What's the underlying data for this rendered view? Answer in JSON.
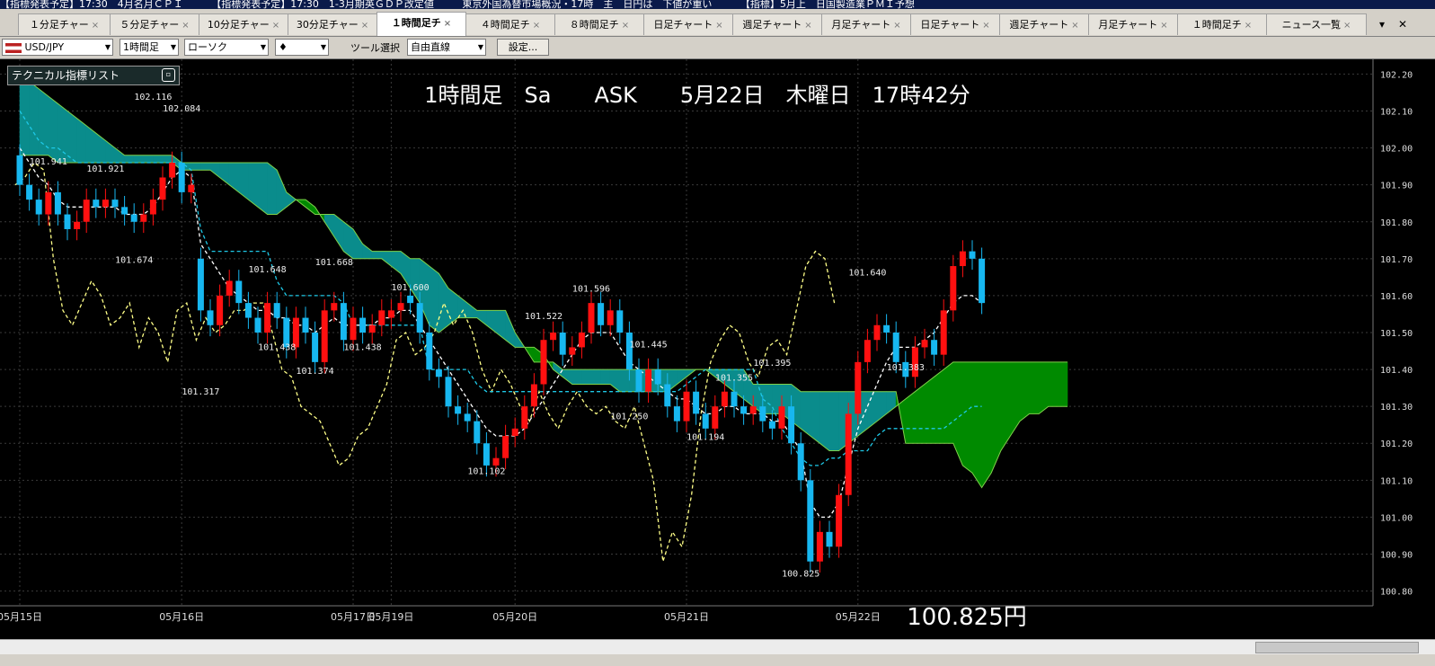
{
  "ticker": [
    "【指標発表予定】17:30　4月名月ＣＰＩ",
    "【指標発表予定】17:30　1-3月期英ＧＤＰ改定値",
    "東京外国為替市場概況・17時　主　日円は　下値が重い",
    "【指標】5月上　日国製造業ＰＭＩ予想"
  ],
  "tabs": [
    "１分足チャー",
    "５分足チャー",
    "10分足チャー",
    "30分足チャー",
    "１時間足チ",
    "４時間足チ",
    "８時間足チ",
    "日足チャート",
    "週足チャート",
    "月足チャート",
    "日足チャート",
    "週足チャート",
    "月足チャート",
    "１時間足チ",
    "ニュース一覧"
  ],
  "tab_close": "×",
  "tab_nav": "▾",
  "window_close": "✕",
  "toolbar": {
    "pair": "USD/JPY",
    "timeframe": "1時間足",
    "chart_type": "ローソク",
    "mark": "♦",
    "tool_label": "ツール選択",
    "tool_value": "自由直線",
    "settings": "設定..."
  },
  "panel": {
    "title": "テクニカル指標リスト",
    "icon": "▫"
  },
  "colors": {
    "up": "#ff1010",
    "down": "#17b7f0",
    "kumo_pos": "#008a00",
    "kumo_neg": "#0a8c8c",
    "tenkan": "#ffffff",
    "kijun": "#1ec8e6",
    "chikou": "#ffff88"
  },
  "chart_data": {
    "type": "candlestick",
    "title": "1時間足　Sa　　ASK　　5月22日　木曜日　17時42分",
    "price_label": "100.825円",
    "ylim": [
      100.76,
      102.24
    ],
    "y_ticks": [
      "102.20",
      "102.10",
      "102.00",
      "101.90",
      "101.80",
      "101.70",
      "101.60",
      "101.50",
      "101.40",
      "101.30",
      "101.20",
      "101.10",
      "101.00",
      "100.90",
      "100.80"
    ],
    "x_labels": [
      {
        "label": "05月15日",
        "i": 0
      },
      {
        "label": "05月16日",
        "i": 17
      },
      {
        "label": "05月17日",
        "i": 35
      },
      {
        "label": "05月19日",
        "i": 39
      },
      {
        "label": "05月20日",
        "i": 52
      },
      {
        "label": "05月21日",
        "i": 70
      },
      {
        "label": "05月22日",
        "i": 88
      }
    ],
    "extrema_labels": [
      {
        "label": "102.116",
        "i": 14,
        "v": 102.116
      },
      {
        "label": "102.084",
        "i": 17,
        "v": 102.084
      },
      {
        "label": "101.941",
        "i": 3,
        "v": 101.941
      },
      {
        "label": "101.921",
        "i": 9,
        "v": 101.921
      },
      {
        "label": "101.674",
        "i": 12,
        "v": 101.674
      },
      {
        "label": "101.648",
        "i": 26,
        "v": 101.648
      },
      {
        "label": "101.668",
        "i": 33,
        "v": 101.668
      },
      {
        "label": "101.317",
        "i": 19,
        "v": 101.317
      },
      {
        "label": "101.438",
        "i": 27,
        "v": 101.438
      },
      {
        "label": "101.374",
        "i": 31,
        "v": 101.374
      },
      {
        "label": "101.438",
        "i": 36,
        "v": 101.438
      },
      {
        "label": "101.600",
        "i": 41,
        "v": 101.6
      },
      {
        "label": "101.102",
        "i": 49,
        "v": 101.102
      },
      {
        "label": "101.522",
        "i": 55,
        "v": 101.522
      },
      {
        "label": "101.596",
        "i": 60,
        "v": 101.596
      },
      {
        "label": "101.445",
        "i": 66,
        "v": 101.445
      },
      {
        "label": "101.250",
        "i": 64,
        "v": 101.25
      },
      {
        "label": "101.194",
        "i": 72,
        "v": 101.194
      },
      {
        "label": "101.355",
        "i": 75,
        "v": 101.355
      },
      {
        "label": "101.395",
        "i": 79,
        "v": 101.395
      },
      {
        "label": "100.825",
        "i": 82,
        "v": 100.825
      },
      {
        "label": "101.640",
        "i": 89,
        "v": 101.64
      },
      {
        "label": "101.383",
        "i": 93,
        "v": 101.383
      }
    ],
    "closes": [
      101.9,
      101.86,
      101.82,
      101.88,
      101.82,
      101.78,
      101.8,
      101.86,
      101.84,
      101.86,
      101.84,
      101.82,
      101.8,
      101.82,
      101.86,
      101.92,
      101.96,
      101.88,
      101.9,
      101.56,
      101.52,
      101.6,
      101.64,
      101.58,
      101.54,
      101.5,
      101.58,
      101.54,
      101.46,
      101.54,
      101.5,
      101.42,
      101.56,
      101.58,
      101.48,
      101.54,
      101.5,
      101.52,
      101.56,
      101.56,
      101.58,
      101.58,
      101.5,
      101.4,
      101.38,
      101.3,
      101.28,
      101.26,
      101.2,
      101.14,
      101.16,
      101.22,
      101.24,
      101.3,
      101.36,
      101.48,
      101.5,
      101.44,
      101.46,
      101.5,
      101.58,
      101.52,
      101.56,
      101.5,
      101.4,
      101.34,
      101.4,
      101.36,
      101.3,
      101.26,
      101.34,
      101.28,
      101.24,
      101.3,
      101.34,
      101.3,
      101.28,
      101.3,
      101.26,
      101.24,
      101.3,
      101.2,
      101.1,
      100.88,
      100.96,
      100.92,
      101.06,
      101.28,
      101.42,
      101.48,
      101.52,
      101.5,
      101.42,
      101.38,
      101.46,
      101.48,
      101.44,
      101.56,
      101.68,
      101.72,
      101.7,
      101.58
    ],
    "opens": [
      101.98,
      101.9,
      101.86,
      101.82,
      101.88,
      101.82,
      101.78,
      101.8,
      101.86,
      101.84,
      101.86,
      101.84,
      101.82,
      101.8,
      101.82,
      101.86,
      101.92,
      101.96,
      101.88,
      101.7,
      101.56,
      101.52,
      101.6,
      101.64,
      101.58,
      101.54,
      101.5,
      101.58,
      101.54,
      101.46,
      101.54,
      101.5,
      101.42,
      101.56,
      101.58,
      101.48,
      101.54,
      101.5,
      101.52,
      101.54,
      101.56,
      101.6,
      101.58,
      101.5,
      101.4,
      101.38,
      101.3,
      101.28,
      101.26,
      101.2,
      101.14,
      101.16,
      101.22,
      101.24,
      101.3,
      101.36,
      101.48,
      101.5,
      101.44,
      101.46,
      101.5,
      101.58,
      101.52,
      101.56,
      101.5,
      101.4,
      101.34,
      101.4,
      101.36,
      101.3,
      101.26,
      101.34,
      101.28,
      101.24,
      101.3,
      101.34,
      101.3,
      101.28,
      101.3,
      101.26,
      101.24,
      101.3,
      101.2,
      101.1,
      100.88,
      100.96,
      100.92,
      101.06,
      101.28,
      101.42,
      101.48,
      101.52,
      101.5,
      101.42,
      101.38,
      101.46,
      101.48,
      101.44,
      101.56,
      101.68,
      101.72,
      101.7
    ],
    "tenkan": [
      102.0,
      101.96,
      101.92,
      101.9,
      101.86,
      101.84,
      101.84,
      101.84,
      101.84,
      101.84,
      101.84,
      101.82,
      101.82,
      101.82,
      101.84,
      101.88,
      101.92,
      101.94,
      101.92,
      101.74,
      101.7,
      101.66,
      101.62,
      101.6,
      101.58,
      101.56,
      101.56,
      101.54,
      101.54,
      101.52,
      101.52,
      101.5,
      101.52,
      101.54,
      101.52,
      101.52,
      101.52,
      101.52,
      101.54,
      101.54,
      101.56,
      101.56,
      101.52,
      101.48,
      101.44,
      101.4,
      101.36,
      101.32,
      101.28,
      101.24,
      101.22,
      101.22,
      101.22,
      101.24,
      101.28,
      101.32,
      101.36,
      101.4,
      101.44,
      101.48,
      101.5,
      101.5,
      101.5,
      101.46,
      101.42,
      101.4,
      101.38,
      101.36,
      101.34,
      101.32,
      101.32,
      101.3,
      101.28,
      101.28,
      101.3,
      101.3,
      101.28,
      101.28,
      101.28,
      101.26,
      101.26,
      101.22,
      101.18,
      101.04,
      101.0,
      101.0,
      101.04,
      101.14,
      101.24,
      101.3,
      101.36,
      101.42,
      101.46,
      101.46,
      101.46,
      101.48,
      101.5,
      101.54,
      101.58,
      101.6,
      101.6,
      101.58
    ],
    "kijun": [
      102.1,
      102.06,
      102.02,
      102.0,
      102.0,
      101.98,
      101.96,
      101.96,
      101.96,
      101.96,
      101.96,
      101.96,
      101.96,
      101.96,
      101.96,
      101.96,
      101.96,
      101.96,
      101.94,
      101.78,
      101.72,
      101.72,
      101.72,
      101.72,
      101.72,
      101.72,
      101.72,
      101.64,
      101.6,
      101.6,
      101.6,
      101.6,
      101.6,
      101.6,
      101.58,
      101.52,
      101.52,
      101.52,
      101.52,
      101.52,
      101.52,
      101.52,
      101.52,
      101.4,
      101.4,
      101.4,
      101.4,
      101.4,
      101.36,
      101.34,
      101.34,
      101.34,
      101.34,
      101.34,
      101.34,
      101.34,
      101.34,
      101.34,
      101.34,
      101.34,
      101.34,
      101.34,
      101.34,
      101.34,
      101.34,
      101.34,
      101.34,
      101.34,
      101.34,
      101.34,
      101.36,
      101.38,
      101.4,
      101.4,
      101.4,
      101.4,
      101.4,
      101.4,
      101.32,
      101.3,
      101.24,
      101.2,
      101.16,
      101.14,
      101.14,
      101.16,
      101.16,
      101.18,
      101.18,
      101.18,
      101.22,
      101.24,
      101.24,
      101.24,
      101.24,
      101.24,
      101.24,
      101.24,
      101.26,
      101.28,
      101.3,
      101.3
    ],
    "chikou": [
      101.9,
      101.92,
      101.96,
      101.94,
      101.7,
      101.56,
      101.52,
      101.58,
      101.64,
      101.6,
      101.52,
      101.54,
      101.58,
      101.46,
      101.54,
      101.5,
      101.42,
      101.56,
      101.58,
      101.48,
      101.54,
      101.5,
      101.52,
      101.56,
      101.56,
      101.58,
      101.58,
      101.5,
      101.4,
      101.38,
      101.3,
      101.28,
      101.26,
      101.2,
      101.14,
      101.16,
      101.22,
      101.24,
      101.3,
      101.36,
      101.48,
      101.5,
      101.44,
      101.46,
      101.5,
      101.58,
      101.52,
      101.56,
      101.5,
      101.4,
      101.34,
      101.4,
      101.36,
      101.3,
      101.26,
      101.34,
      101.28,
      101.24,
      101.3,
      101.34,
      101.3,
      101.28,
      101.3,
      101.26,
      101.24,
      101.3,
      101.2,
      101.1,
      100.88,
      100.96,
      100.92,
      101.06,
      101.28,
      101.42,
      101.48,
      101.52,
      101.5,
      101.42,
      101.38,
      101.46,
      101.48,
      101.44,
      101.56,
      101.68,
      101.72,
      101.7,
      101.58
    ],
    "senkou_a": [
      101.98,
      101.98,
      101.98,
      101.98,
      101.96,
      101.96,
      101.96,
      101.96,
      101.96,
      101.96,
      101.96,
      101.96,
      101.96,
      101.96,
      101.96,
      101.96,
      101.96,
      101.94,
      101.94,
      101.94,
      101.94,
      101.92,
      101.9,
      101.88,
      101.86,
      101.84,
      101.82,
      101.82,
      101.84,
      101.86,
      101.86,
      101.84,
      101.8,
      101.76,
      101.72,
      101.7,
      101.7,
      101.7,
      101.7,
      101.68,
      101.66,
      101.62,
      101.58,
      101.52,
      101.5,
      101.52,
      101.54,
      101.54,
      101.54,
      101.52,
      101.5,
      101.48,
      101.46,
      101.46,
      101.46,
      101.44,
      101.4,
      101.38,
      101.36,
      101.36,
      101.36,
      101.36,
      101.36,
      101.34,
      101.34,
      101.34,
      101.34,
      101.34,
      101.34,
      101.36,
      101.38,
      101.4,
      101.4,
      101.38,
      101.36,
      101.34,
      101.32,
      101.3,
      101.28,
      101.28,
      101.28,
      101.26,
      101.24,
      101.22,
      101.2,
      101.18,
      101.18,
      101.2,
      101.22,
      101.24,
      101.26,
      101.28,
      101.3,
      101.32,
      101.34,
      101.36,
      101.38,
      101.4,
      101.42,
      101.42,
      101.42,
      101.42,
      101.42,
      101.42,
      101.42,
      101.42,
      101.42,
      101.42,
      101.42,
      101.42,
      101.42
    ],
    "senkou_b": [
      102.2,
      102.18,
      102.16,
      102.14,
      102.12,
      102.1,
      102.08,
      102.06,
      102.04,
      102.02,
      102.0,
      101.98,
      101.98,
      101.98,
      101.98,
      101.98,
      101.98,
      101.96,
      101.96,
      101.96,
      101.96,
      101.96,
      101.96,
      101.96,
      101.96,
      101.96,
      101.96,
      101.94,
      101.88,
      101.86,
      101.84,
      101.82,
      101.82,
      101.82,
      101.8,
      101.78,
      101.74,
      101.72,
      101.72,
      101.72,
      101.72,
      101.7,
      101.7,
      101.68,
      101.66,
      101.62,
      101.6,
      101.58,
      101.56,
      101.56,
      101.56,
      101.56,
      101.5,
      101.46,
      101.42,
      101.42,
      101.42,
      101.4,
      101.4,
      101.4,
      101.4,
      101.4,
      101.4,
      101.4,
      101.4,
      101.4,
      101.4,
      101.4,
      101.4,
      101.4,
      101.4,
      101.4,
      101.4,
      101.4,
      101.4,
      101.4,
      101.4,
      101.36,
      101.36,
      101.36,
      101.36,
      101.36,
      101.34,
      101.34,
      101.34,
      101.34,
      101.34,
      101.34,
      101.34,
      101.34,
      101.34,
      101.34,
      101.34,
      101.2,
      101.2,
      101.2,
      101.2,
      101.2,
      101.2,
      101.14,
      101.12,
      101.08,
      101.12,
      101.18,
      101.22,
      101.26,
      101.28,
      101.28,
      101.3,
      101.3,
      101.3
    ]
  }
}
